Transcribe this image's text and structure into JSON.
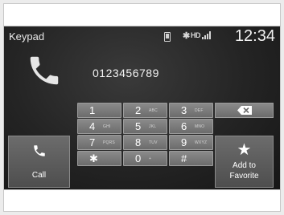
{
  "header": {
    "title": "Keypad",
    "clock": "12:34",
    "status_icons": [
      "phone-icon",
      "bluetooth-icon",
      "hd-icon",
      "signal-icon"
    ],
    "bt_glyph": "✱",
    "hd_text": "HD"
  },
  "dialed_number": "0123456789",
  "keypad": {
    "k1": {
      "digit": "1",
      "letters": ""
    },
    "k2": {
      "digit": "2",
      "letters": "ABC"
    },
    "k3": {
      "digit": "3",
      "letters": "DEF"
    },
    "k4": {
      "digit": "4",
      "letters": "GHI"
    },
    "k5": {
      "digit": "5",
      "letters": "JKL"
    },
    "k6": {
      "digit": "6",
      "letters": "MNO"
    },
    "k7": {
      "digit": "7",
      "letters": "PQRS"
    },
    "k8": {
      "digit": "8",
      "letters": "TUV"
    },
    "k9": {
      "digit": "9",
      "letters": "WXYZ"
    },
    "kstar": {
      "digit": "✱",
      "letters": ""
    },
    "k0": {
      "digit": "0",
      "letters": "+"
    },
    "khash": {
      "digit": "#",
      "letters": ""
    }
  },
  "buttons": {
    "call_label": "Call",
    "fav_line1": "Add to",
    "fav_line2": "Favorite",
    "star_glyph": "★"
  },
  "colors": {
    "screen_bg": "#242424",
    "key_bg": "#7a7a7a",
    "text": "#ffffff"
  }
}
